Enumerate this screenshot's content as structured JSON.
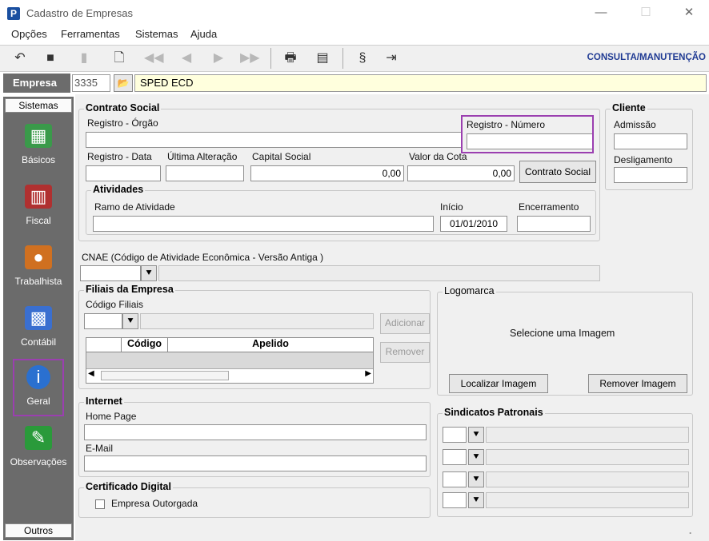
{
  "window": {
    "title": "Cadastro de Empresas",
    "icon_letter": "P",
    "min": "—",
    "max": "☐",
    "close": "✕"
  },
  "menu": [
    "Opções",
    "Ferramentas",
    "Sistemas",
    "Ajuda"
  ],
  "toolbar": {
    "mode": "CONSULTA/MANUTENÇÃO"
  },
  "empresa": {
    "label": "Empresa",
    "code": "3335",
    "name": "SPED ECD"
  },
  "sidebar": {
    "header_top": "Sistemas",
    "header_bottom": "Outros",
    "items": [
      {
        "label": "Básicos",
        "icon": "spreadsheet-icon",
        "color": "#3a9a4a"
      },
      {
        "label": "Fiscal",
        "icon": "fiscal-icon",
        "color": "#b03030"
      },
      {
        "label": "Trabalhista",
        "icon": "worker-icon",
        "color": "#d07020"
      },
      {
        "label": "Contábil",
        "icon": "calculator-icon",
        "color": "#3a6fd0"
      },
      {
        "label": "Geral",
        "icon": "info-icon",
        "color": "#2a70d0"
      },
      {
        "label": "Observações",
        "icon": "notes-icon",
        "color": "#2a9a3a"
      }
    ]
  },
  "contrato": {
    "legend": "Contrato Social",
    "registro_orgao": {
      "label": "Registro - Órgão",
      "value": ""
    },
    "registro_numero": {
      "label": "Registro - Número",
      "value": ""
    },
    "registro_data": {
      "label": "Registro - Data",
      "value": ""
    },
    "ultima_alteracao": {
      "label": "Última Alteração",
      "value": ""
    },
    "capital_social": {
      "label": "Capital Social",
      "value": "0,00"
    },
    "valor_cota": {
      "label": "Valor da Cota",
      "value": "0,00"
    },
    "contrato_button": "Contrato Social",
    "atividades": {
      "legend": "Atividades",
      "ramo": {
        "label": "Ramo de Atividade",
        "value": ""
      },
      "inicio": {
        "label": "Início",
        "value": "01/01/2010"
      },
      "encerramento": {
        "label": "Encerramento",
        "value": ""
      }
    }
  },
  "cliente": {
    "legend": "Cliente",
    "admissao": {
      "label": "Admissão",
      "value": ""
    },
    "desligamento": {
      "label": "Desligamento",
      "value": ""
    }
  },
  "cnae": {
    "label": "CNAE (Código de Atividade Econômica - Versão Antiga )",
    "value": ""
  },
  "filiais": {
    "legend": "Filiais da Empresa",
    "codigo_label": "Código Filiais",
    "adicionar": "Adicionar",
    "remover": "Remover",
    "col_codigo": "Código",
    "col_apelido": "Apelido"
  },
  "logomarca": {
    "legend": "Logomarca",
    "placeholder": "Selecione  uma  Imagem",
    "localizar": "Localizar Imagem",
    "remover": "Remover Imagem"
  },
  "internet": {
    "legend": "Internet",
    "home_page": {
      "label": "Home Page",
      "value": ""
    },
    "email": {
      "label": "E-Mail",
      "value": ""
    }
  },
  "sindicatos": {
    "legend": "Sindicatos Patronais"
  },
  "certificado": {
    "legend": "Certificado Digital",
    "checkbox_label": "Empresa Outorgada"
  }
}
